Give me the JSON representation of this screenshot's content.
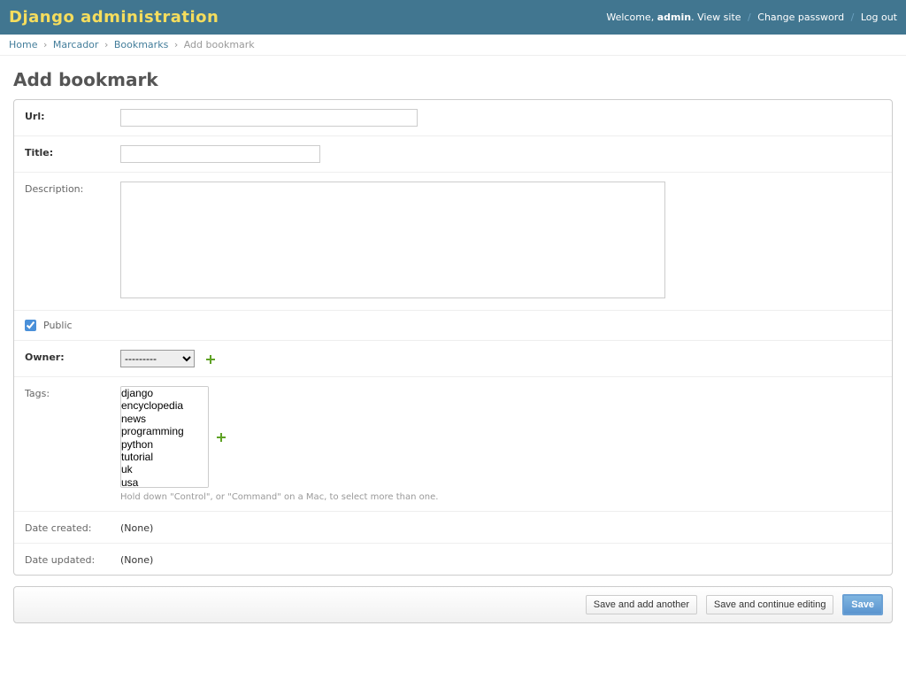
{
  "header": {
    "branding": "Django administration",
    "welcome": "Welcome,",
    "user": "admin",
    "period": ".",
    "view_site": "View site",
    "change_password": "Change password",
    "logout": "Log out"
  },
  "breadcrumbs": {
    "items": [
      "Home",
      "Marcador",
      "Bookmarks"
    ],
    "current": "Add bookmark",
    "sep": "›"
  },
  "page": {
    "title": "Add bookmark"
  },
  "form": {
    "url": {
      "label": "Url:",
      "value": ""
    },
    "title": {
      "label": "Title:",
      "value": ""
    },
    "description": {
      "label": "Description:",
      "value": ""
    },
    "public": {
      "label": "Public",
      "checked": true
    },
    "owner": {
      "label": "Owner:",
      "selected": "---------",
      "options": [
        "---------"
      ]
    },
    "tags": {
      "label": "Tags:",
      "options": [
        "django",
        "encyclopedia",
        "news",
        "programming",
        "python",
        "tutorial",
        "uk",
        "usa"
      ],
      "help": "Hold down \"Control\", or \"Command\" on a Mac, to select more than one."
    },
    "date_created": {
      "label": "Date created:",
      "value": "(None)"
    },
    "date_updated": {
      "label": "Date updated:",
      "value": "(None)"
    }
  },
  "submit": {
    "add_another": "Save and add another",
    "continue": "Save and continue editing",
    "save": "Save"
  }
}
